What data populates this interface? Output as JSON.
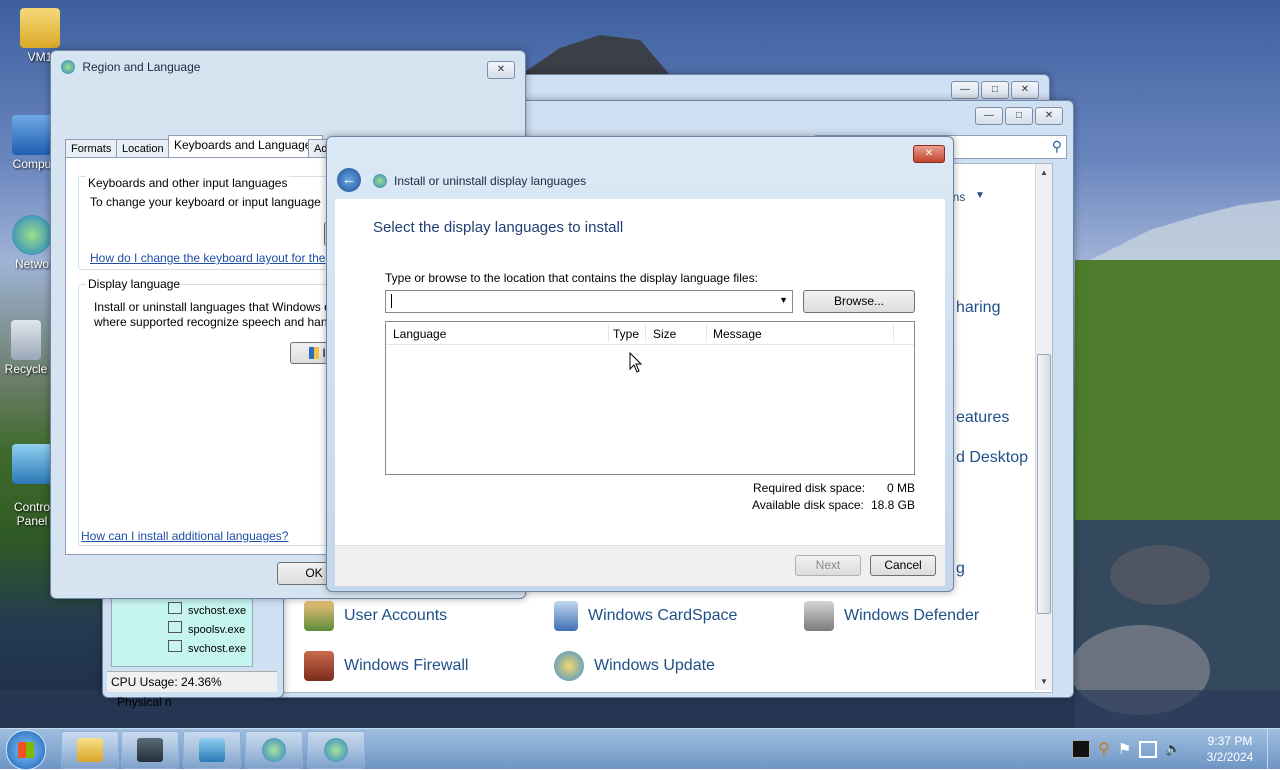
{
  "desktop": {
    "icons": [
      {
        "label": "VM1"
      },
      {
        "label": "Compu"
      },
      {
        "label": "Netwo"
      },
      {
        "label": "Recycle"
      },
      {
        "label": "Contro\nPanel"
      }
    ]
  },
  "region_dialog": {
    "title": "Region and Language",
    "tabs": [
      "Formats",
      "Location",
      "Keyboards and Languages",
      "Administrative"
    ],
    "keyboards_group": "Keyboards and other input languages",
    "keyboards_text": "To change your keyboard or input language",
    "keyboards_link": "How do I change the keyboard layout for the",
    "display_group": "Display language",
    "display_text_1": "Install or uninstall languages that Windows o",
    "display_text_2": "where supported recognize speech and hand",
    "install_button_partial": "I",
    "bottom_link": "How can I install additional languages?",
    "ok_label": "OK"
  },
  "install_dialog": {
    "title": "Install or uninstall display languages",
    "heading": "Select the display languages to install",
    "location_label": "Type or browse to the location that contains the display language files:",
    "location_value": "",
    "browse_label": "Browse...",
    "columns": [
      "Language",
      "Type",
      "Size",
      "Message"
    ],
    "rows": [],
    "required_label": "Required disk space:",
    "required_value": "0 MB",
    "available_label": "Available disk space:",
    "available_value": "18.8 GB",
    "next_label": "Next",
    "cancel_label": "Cancel"
  },
  "control_panel": {
    "partial_labels": [
      "ons",
      "haring",
      "eatures",
      "d Desktop",
      "g"
    ],
    "items": [
      {
        "label": "User Accounts",
        "icon": "user-accounts-icon"
      },
      {
        "label": "Windows CardSpace",
        "icon": "cardspace-icon"
      },
      {
        "label": "Windows Defender",
        "icon": "defender-icon"
      },
      {
        "label": "Windows Firewall",
        "icon": "firewall-icon"
      },
      {
        "label": "Windows Update",
        "icon": "windows-update-icon"
      }
    ]
  },
  "task_manager": {
    "processes": [
      "svchost.exe",
      "spoolsv.exe",
      "svchost.exe"
    ],
    "cpu_usage": "CPU Usage: 24.36%",
    "physical_partial": "Physical n"
  },
  "taskbar": {
    "clock_time": "9:37 PM",
    "clock_date": "3/2/2024"
  },
  "colors": {
    "accent_blue": "#1f4f87",
    "close_red": "#c4432c",
    "window_frame": "#cfe0f3"
  }
}
